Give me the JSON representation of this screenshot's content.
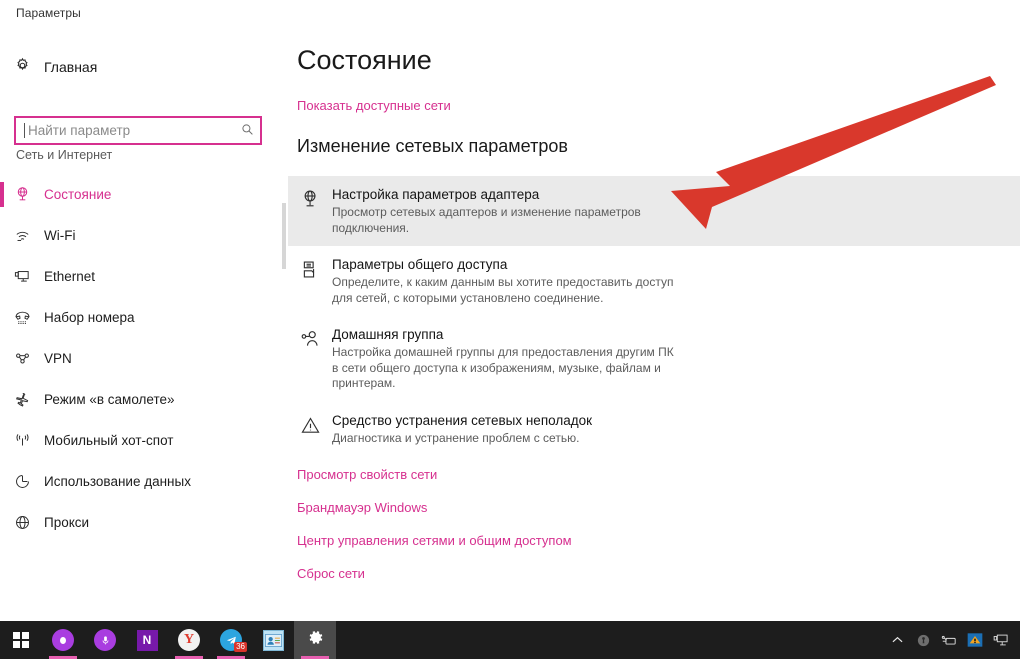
{
  "window": {
    "title": "Параметры"
  },
  "nav": {
    "home_label": "Главная",
    "home_icon": "gear-icon",
    "search": {
      "placeholder": "Найти параметр",
      "value": "",
      "icon": "search-icon"
    },
    "section_title": "Сеть и Интернет",
    "accent_color": "#d6308f",
    "items": [
      {
        "label": "Состояние",
        "icon": "globe-status-icon",
        "selected": true
      },
      {
        "label": "Wi-Fi",
        "icon": "wifi-icon",
        "selected": false
      },
      {
        "label": "Ethernet",
        "icon": "ethernet-icon",
        "selected": false
      },
      {
        "label": "Набор номера",
        "icon": "dialup-phone-icon",
        "selected": false
      },
      {
        "label": "VPN",
        "icon": "vpn-icon",
        "selected": false
      },
      {
        "label": "Режим «в самолете»",
        "icon": "airplane-icon",
        "selected": false
      },
      {
        "label": "Мобильный хот-спот",
        "icon": "hotspot-icon",
        "selected": false
      },
      {
        "label": "Использование данных",
        "icon": "data-usage-icon",
        "selected": false
      },
      {
        "label": "Прокси",
        "icon": "proxy-globe-icon",
        "selected": false
      }
    ]
  },
  "content": {
    "page_title": "Состояние",
    "show_networks_link": "Показать доступные сети",
    "section_heading": "Изменение сетевых параметров",
    "settings": [
      {
        "name": "Настройка параметров адаптера",
        "desc": "Просмотр сетевых адаптеров и изменение параметров подключения.",
        "icon": "adapter-globe-icon",
        "highlighted": true
      },
      {
        "name": "Параметры общего доступа",
        "desc": "Определите, к каким данным вы хотите предоставить доступ для сетей, с которыми установлено соединение.",
        "icon": "sharing-icon",
        "highlighted": false
      },
      {
        "name": "Домашняя группа",
        "desc": "Настройка домашней группы для предоставления другим ПК в сети общего доступа к изображениям, музыке, файлам и принтерам.",
        "icon": "homegroup-icon",
        "highlighted": false
      },
      {
        "name": "Средство устранения сетевых неполадок",
        "desc": "Диагностика и устранение проблем с сетью.",
        "icon": "warning-triangle-icon",
        "highlighted": false
      }
    ],
    "links": [
      "Просмотр свойств сети",
      "Брандмауэр Windows",
      "Центр управления сетями и общим доступом",
      "Сброс сети"
    ]
  },
  "annotation": {
    "type": "arrow",
    "color": "#d9382c",
    "points_at": "Настройка параметров адаптера"
  },
  "taskbar": {
    "background": "#1d1d1d",
    "items": [
      {
        "name": "start-button",
        "icon": "windows-logo-icon",
        "active": false,
        "badge": ""
      },
      {
        "name": "cortana-button",
        "icon": "cortana-circle-icon",
        "active": false,
        "badge": ""
      },
      {
        "name": "voice-search-button",
        "icon": "microphone-icon",
        "active": false,
        "badge": ""
      },
      {
        "name": "onenote-button",
        "icon": "onenote-icon",
        "active": false,
        "badge": ""
      },
      {
        "name": "yandex-browser-button",
        "icon": "yandex-icon",
        "active": false,
        "badge": ""
      },
      {
        "name": "telegram-button",
        "icon": "telegram-icon",
        "active": false,
        "badge": "36"
      },
      {
        "name": "contacts-button",
        "icon": "contacts-icon",
        "active": false,
        "badge": ""
      },
      {
        "name": "settings-button",
        "icon": "gear-icon",
        "active": true,
        "badge": ""
      }
    ],
    "tray": [
      {
        "name": "show-hidden-icons",
        "glyph": "⌃"
      },
      {
        "name": "tray-shield-icon",
        "glyph": "◉"
      },
      {
        "name": "tray-plug-icon",
        "glyph": "⚲"
      },
      {
        "name": "tray-app-icon",
        "glyph": "▲"
      },
      {
        "name": "tray-network-icon",
        "glyph": "🖳"
      }
    ]
  }
}
